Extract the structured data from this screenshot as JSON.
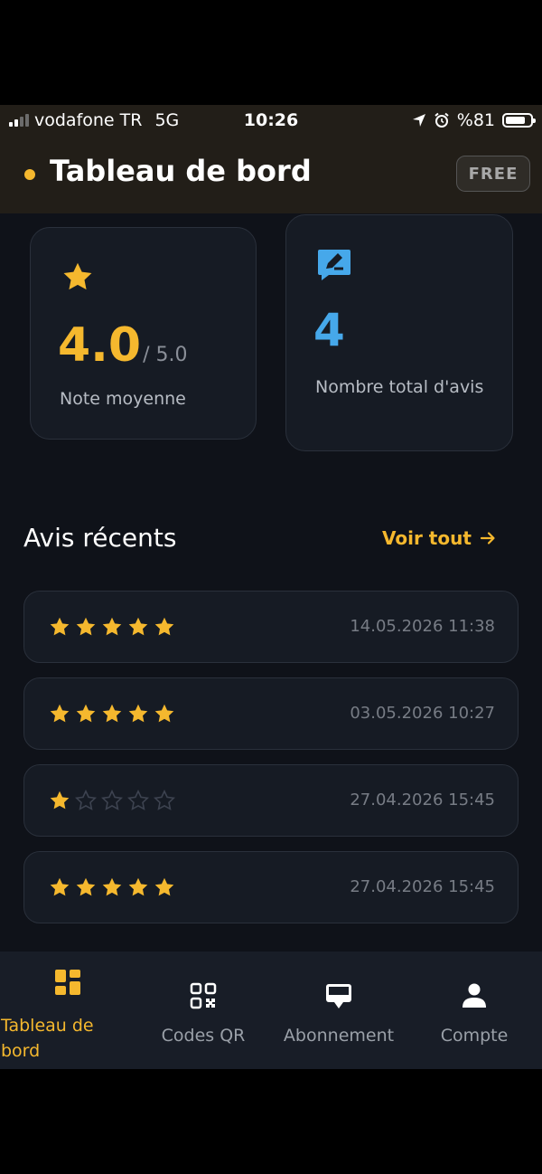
{
  "status_bar": {
    "carrier": "vodafone TR",
    "network": "5G",
    "time": "10:26",
    "battery": "%81"
  },
  "header": {
    "title": "Tableau de bord",
    "plan_badge": "FREE"
  },
  "stats": {
    "rating": {
      "value": "4.0",
      "max": "/ 5.0",
      "label": "Note moyenne"
    },
    "total": {
      "value": "4",
      "label": "Nombre total d'avis"
    }
  },
  "recent": {
    "title": "Avis récents",
    "see_all": "Voir tout",
    "reviews": [
      {
        "rating": 5,
        "date": "14.05.2026 11:38"
      },
      {
        "rating": 5,
        "date": "03.05.2026 10:27"
      },
      {
        "rating": 1,
        "date": "27.04.2026 15:45"
      },
      {
        "rating": 5,
        "date": "27.04.2026 15:45"
      }
    ]
  },
  "nav": {
    "items": [
      {
        "label": "Tableau de bord",
        "icon": "dashboard-icon",
        "active": true
      },
      {
        "label": "Codes QR",
        "icon": "qr-code-icon",
        "active": false
      },
      {
        "label": "Abonnement",
        "icon": "subscription-icon",
        "active": false
      },
      {
        "label": "Compte",
        "icon": "user-icon",
        "active": false
      }
    ]
  },
  "colors": {
    "accent": "#f5b82e",
    "info": "#46a8ea",
    "background": "#0f1219",
    "card": "#161b24"
  }
}
